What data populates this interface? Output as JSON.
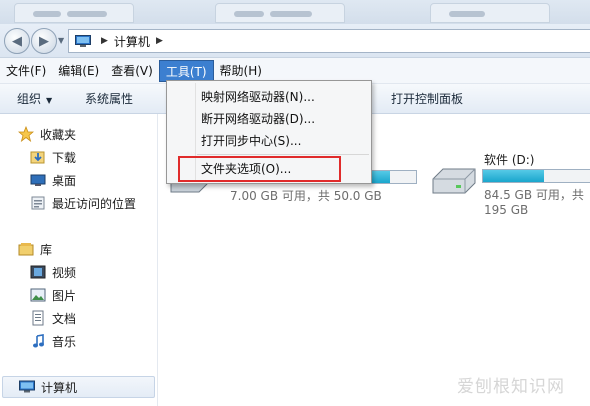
{
  "window": {
    "tabs": [
      {
        "label": ""
      },
      {
        "label": ""
      },
      {
        "label": ""
      }
    ]
  },
  "address": {
    "path": "计算机"
  },
  "menubar": {
    "items": [
      "文件(F)",
      "编辑(E)",
      "查看(V)",
      "工具(T)",
      "帮助(H)"
    ],
    "active_index": 3
  },
  "toolbar": {
    "organize": "组织",
    "system_properties": "系统属性",
    "open_control_panel": "打开控制面板"
  },
  "tools_menu": {
    "items": [
      "映射网络驱动器(N)...",
      "断开网络驱动器(D)...",
      "打开同步中心(S)...",
      "文件夹选项(O)..."
    ],
    "highlighted_item": "文件夹选项(O)..."
  },
  "sidebar": {
    "favorites": "收藏夹",
    "favorites_items": [
      "下载",
      "桌面",
      "最近访问的位置"
    ],
    "libraries": "库",
    "library_items": [
      "视频",
      "图片",
      "文档",
      "音乐"
    ],
    "computer": "计算机"
  },
  "drives": [
    {
      "name": "",
      "free_text": "7.00 GB 可用，共 50.0 GB",
      "used_fraction": 0.86
    },
    {
      "name": "软件 (D:)",
      "free_text": "84.5 GB 可用，共 195 GB",
      "used_fraction": 0.57
    }
  ],
  "colors": {
    "menu_active": "#3c7fd0",
    "drive_bar": "#1aa6cd",
    "highlight_box": "#e02b2b"
  },
  "watermark": "爱刨根知识网"
}
